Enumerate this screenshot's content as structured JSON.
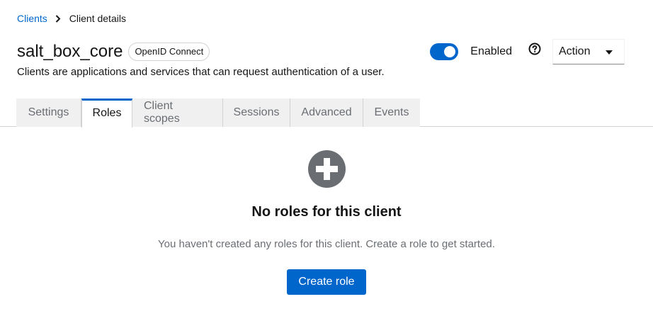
{
  "breadcrumb": {
    "items": [
      {
        "label": "Clients"
      },
      {
        "label": "Client details"
      }
    ]
  },
  "header": {
    "title": "salt_box_core",
    "badge": "OpenID Connect",
    "description": "Clients are applications and services that can request authentication of a user.",
    "enabled_label": "Enabled",
    "enabled": true,
    "action_label": "Action"
  },
  "tabs": [
    {
      "label": "Settings",
      "active": false
    },
    {
      "label": "Roles",
      "active": true
    },
    {
      "label": "Client scopes",
      "active": false
    },
    {
      "label": "Sessions",
      "active": false
    },
    {
      "label": "Advanced",
      "active": false
    },
    {
      "label": "Events",
      "active": false
    }
  ],
  "empty_state": {
    "icon": "plus-circle-icon",
    "title": "No roles for this client",
    "body": "You haven't created any roles for this client. Create a role to get started.",
    "button_label": "Create role"
  },
  "colors": {
    "accent": "#0066cc",
    "icon_gray": "#6a6e73",
    "tab_bg": "#f0f0f0"
  }
}
